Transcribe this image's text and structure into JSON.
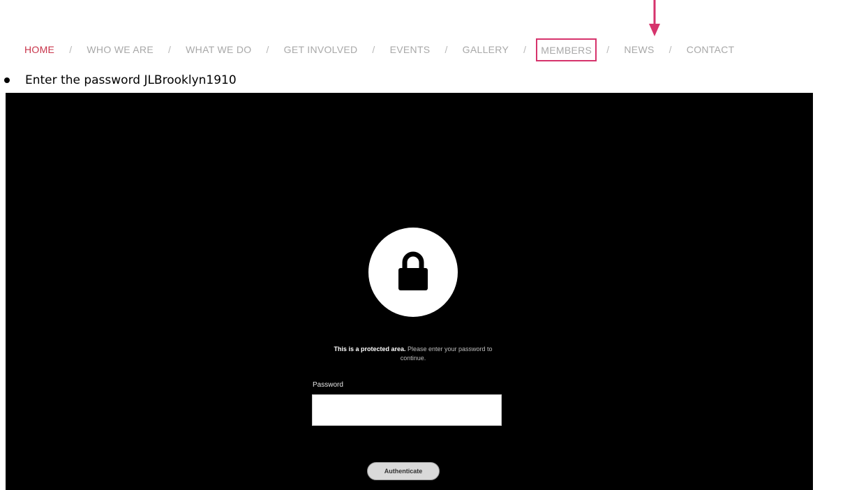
{
  "nav": {
    "items": [
      {
        "label": "HOME"
      },
      {
        "label": "WHO WE ARE"
      },
      {
        "label": "WHAT WE DO"
      },
      {
        "label": "GET INVOLVED"
      },
      {
        "label": "EVENTS"
      },
      {
        "label": "GALLERY"
      },
      {
        "label": "MEMBERS"
      },
      {
        "label": "NEWS"
      },
      {
        "label": "CONTACT"
      }
    ],
    "separator": "/",
    "active_item": "HOME",
    "highlighted_item": "MEMBERS"
  },
  "instruction": {
    "text": "Enter the password JLBrooklyn1910"
  },
  "login": {
    "message_bold": "This is a protected area.",
    "message_rest": " Please enter your password to continue.",
    "password_label": "Password",
    "password_value": "",
    "button_label": "Authenticate"
  },
  "colors": {
    "active_nav": "#c8344a",
    "highlight": "#d6336c",
    "nav_text": "#a8a8a8",
    "panel_bg": "#000000"
  },
  "icons": {
    "lock": "lock-icon",
    "arrow": "arrow-down-icon",
    "bullet": "bullet-icon"
  }
}
